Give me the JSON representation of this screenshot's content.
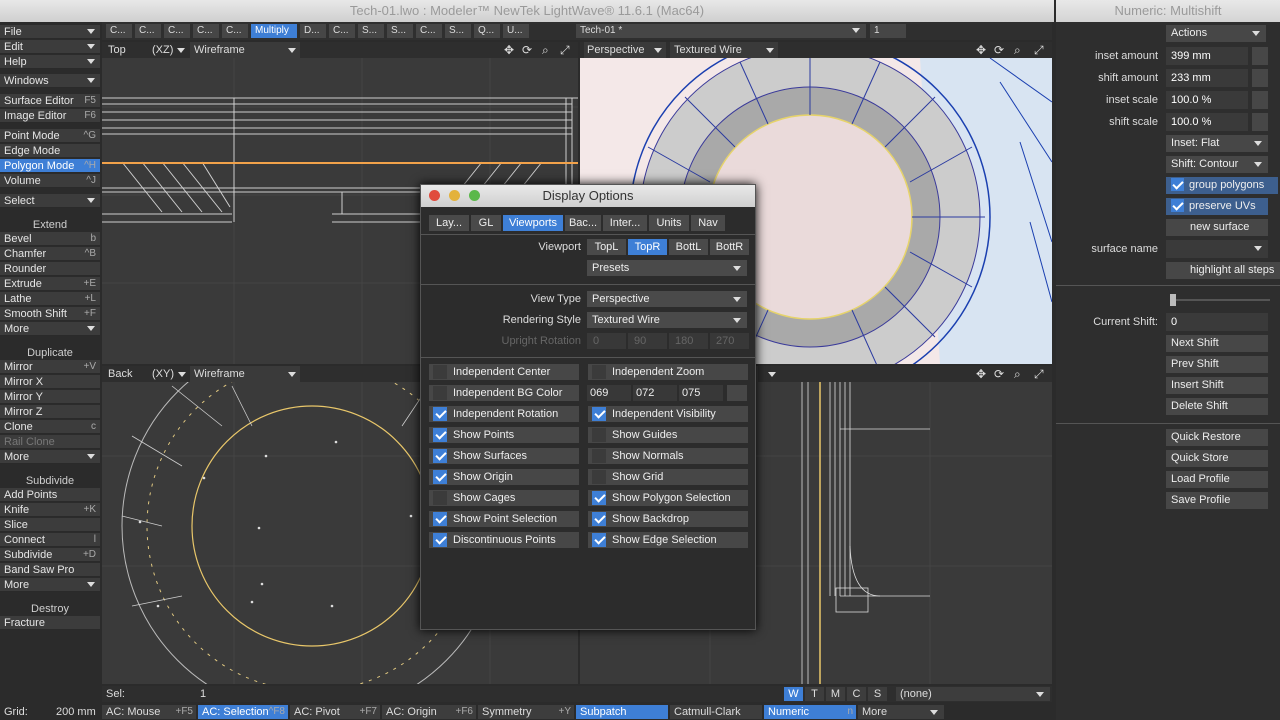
{
  "window_title": "Tech-01.lwo : Modeler™ NewTek LightWave® 11.6.1 (Mac64)",
  "numeric_title": "Numeric: Multishift",
  "left_menu": {
    "top": [
      {
        "label": "File"
      },
      {
        "label": "Edit"
      },
      {
        "label": "Help"
      },
      {
        "label": "Windows"
      }
    ],
    "editors": [
      {
        "label": "Surface Editor",
        "key": "F5"
      },
      {
        "label": "Image Editor",
        "key": "F6"
      }
    ],
    "modes": [
      {
        "label": "Point Mode",
        "key": "^G"
      },
      {
        "label": "Edge Mode",
        "key": ""
      },
      {
        "label": "Polygon Mode",
        "key": "^H"
      },
      {
        "label": "Volume",
        "key": "^J"
      }
    ],
    "select": "Select",
    "extend_title": "Extend",
    "extend": [
      {
        "label": "Bevel",
        "key": "b"
      },
      {
        "label": "Chamfer",
        "key": "^B"
      },
      {
        "label": "Rounder",
        "key": ""
      },
      {
        "label": "Extrude",
        "key": "+E"
      },
      {
        "label": "Lathe",
        "key": "+L"
      },
      {
        "label": "Smooth Shift",
        "key": "+F"
      },
      {
        "label": "More",
        "key": ""
      }
    ],
    "duplicate_title": "Duplicate",
    "duplicate": [
      {
        "label": "Mirror",
        "key": "+V"
      },
      {
        "label": "Mirror X",
        "key": ""
      },
      {
        "label": "Mirror Y",
        "key": ""
      },
      {
        "label": "Mirror Z",
        "key": ""
      },
      {
        "label": "Clone",
        "key": "c"
      },
      {
        "label": "Rail Clone",
        "key": ""
      },
      {
        "label": "More",
        "key": ""
      }
    ],
    "subdivide_title": "Subdivide",
    "subdivide": [
      {
        "label": "Add Points",
        "key": ""
      },
      {
        "label": "Knife",
        "key": "+K"
      },
      {
        "label": "Slice",
        "key": ""
      },
      {
        "label": "Connect",
        "key": "l"
      },
      {
        "label": "Subdivide",
        "key": "+D"
      },
      {
        "label": "Band Saw Pro",
        "key": ""
      },
      {
        "label": "More",
        "key": ""
      }
    ],
    "destroy_title": "Destroy",
    "destroy": [
      {
        "label": "Fracture",
        "key": ""
      }
    ]
  },
  "topbar": {
    "tabs": [
      "C...",
      "C...",
      "C...",
      "C...",
      "C...",
      "Multiply",
      "D...",
      "C...",
      "S...",
      "S...",
      "C...",
      "S...",
      "Q...",
      "U..."
    ],
    "layer": "Tech-01 *",
    "layer_num": "1"
  },
  "viewports": {
    "top_left": {
      "name": "Top",
      "axis": "(XZ)",
      "mode": "Wireframe"
    },
    "top_right": {
      "name": "Perspective",
      "mode": "Textured Wire"
    },
    "bottom_left": {
      "name": "Back",
      "axis": "(XY)",
      "mode": "Wireframe"
    }
  },
  "dialog": {
    "title": "Display Options",
    "tabs": [
      "Lay...",
      "GL",
      "Viewports",
      "Bac...",
      "Inter...",
      "Units",
      "Nav"
    ],
    "viewport_label": "Viewport",
    "viewport_btns": [
      "TopL",
      "TopR",
      "BottL",
      "BottR"
    ],
    "presets": "Presets",
    "view_type_label": "View Type",
    "view_type": "Perspective",
    "rendering_style_label": "Rendering Style",
    "rendering_style": "Textured Wire",
    "upright_label": "Upright Rotation",
    "upright_vals": [
      "0",
      "90",
      "180",
      "270"
    ],
    "bg_vals": [
      "069",
      "072",
      "075"
    ],
    "left_checks": [
      {
        "label": "Independent Center",
        "on": false
      },
      {
        "label": "Independent BG Color",
        "on": false
      },
      {
        "label": "Independent Rotation",
        "on": true
      },
      {
        "label": "Show Points",
        "on": true
      },
      {
        "label": "Show Surfaces",
        "on": true
      },
      {
        "label": "Show Origin",
        "on": true
      },
      {
        "label": "Show Cages",
        "on": false
      },
      {
        "label": "Show Point Selection",
        "on": true
      },
      {
        "label": "Discontinuous Points",
        "on": true
      }
    ],
    "right_checks": [
      {
        "label": "Independent Zoom",
        "on": false
      },
      {
        "label": "Independent Visibility",
        "on": true
      },
      {
        "label": "Show Guides",
        "on": false
      },
      {
        "label": "Show Normals",
        "on": false
      },
      {
        "label": "Show Grid",
        "on": false
      },
      {
        "label": "Show Polygon Selection",
        "on": true
      },
      {
        "label": "Show Backdrop",
        "on": true
      },
      {
        "label": "Show Edge Selection",
        "on": true
      }
    ]
  },
  "numeric": {
    "actions": "Actions",
    "inset_amount_label": "inset amount",
    "inset_amount": "399 mm",
    "shift_amount_label": "shift amount",
    "shift_amount": "233 mm",
    "inset_scale_label": "inset scale",
    "inset_scale": "100.0 %",
    "shift_scale_label": "shift scale",
    "shift_scale": "100.0 %",
    "inset_mode": "Inset: Flat",
    "shift_mode": "Shift: Contour",
    "group_polygons": "group polygons",
    "preserve_uvs": "preserve UVs",
    "new_surface": "new surface",
    "surface_name_label": "surface name",
    "highlight": "highlight all steps",
    "current_shift_label": "Current Shift:",
    "current_shift": "0",
    "buttons": [
      "Next Shift",
      "Prev Shift",
      "Insert Shift",
      "Delete Shift"
    ],
    "buttons2": [
      "Quick Restore",
      "Quick Store",
      "Load Profile",
      "Save Profile"
    ]
  },
  "status": {
    "sel_label": "Sel:",
    "sel_value": "1",
    "wtmcs": [
      "W",
      "T",
      "M",
      "C",
      "S"
    ],
    "none": "(none)",
    "grid_label": "Grid:",
    "grid_value": "200 mm",
    "bottom": [
      {
        "label": "AC: Mouse",
        "key": "+F5"
      },
      {
        "label": "AC: Selection",
        "key": "^F8"
      },
      {
        "label": "AC: Pivot",
        "key": "+F7"
      },
      {
        "label": "AC: Origin",
        "key": "+F6"
      },
      {
        "label": "Symmetry",
        "key": "+Y"
      },
      {
        "label": "Subpatch",
        "key": ""
      },
      {
        "label": "Catmull-Clark",
        "key": ""
      },
      {
        "label": "Numeric",
        "key": "n"
      },
      {
        "label": "More",
        "key": ""
      }
    ]
  }
}
